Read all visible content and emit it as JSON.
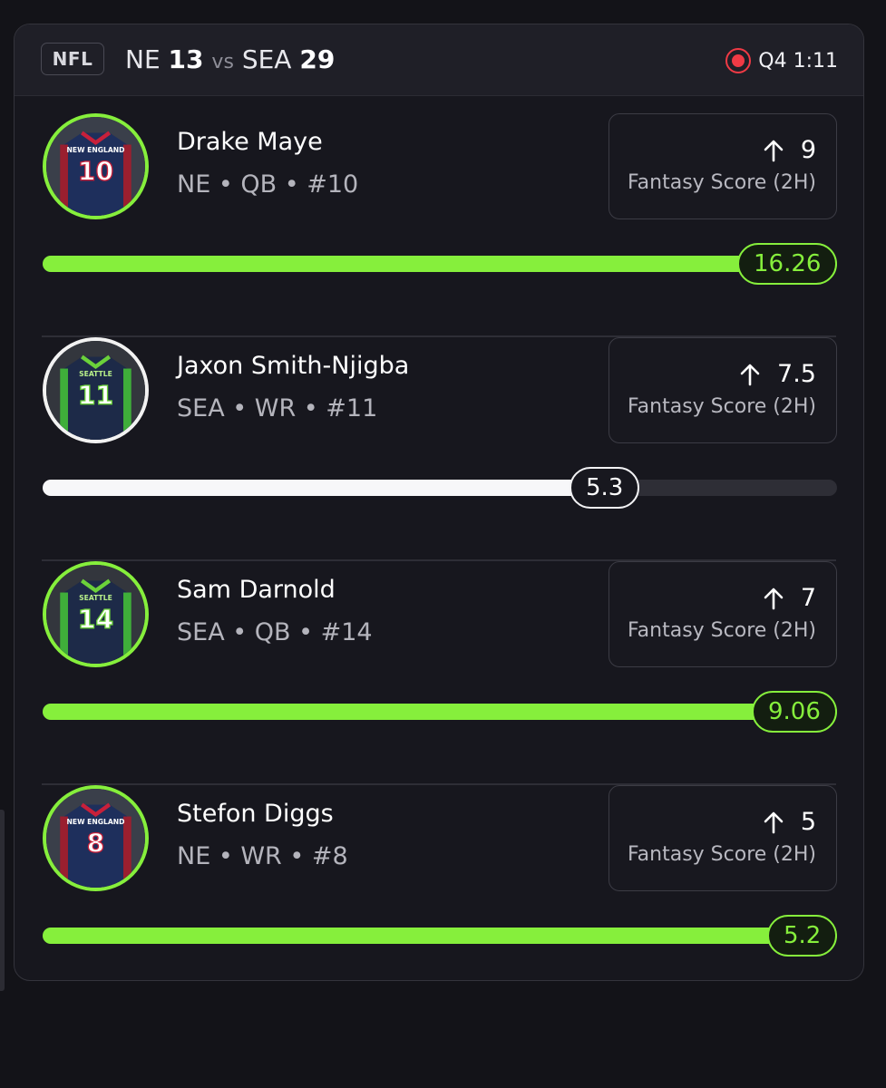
{
  "game": {
    "league": "NFL",
    "away_team": "NE",
    "away_score": "13",
    "vs": "vs",
    "home_team": "SEA",
    "home_score": "29",
    "period_clock": "Q4 1:11",
    "status_icon": "live-record-icon",
    "live_color": "#f03a45"
  },
  "accent_color": "#86ef3c",
  "players": [
    {
      "name": "Drake Maye",
      "meta": "NE • QB • #10",
      "line_value": "9",
      "stat_label": "Fantasy Score (2H)",
      "current": "16.26",
      "progress": 1.0,
      "over": true,
      "jersey_team": "NEW ENGLAND",
      "jersey_number": "10"
    },
    {
      "name": "Jaxon Smith-Njigba",
      "meta": "SEA • WR • #11",
      "line_value": "7.5",
      "stat_label": "Fantasy Score (2H)",
      "current": "5.3",
      "progress": 0.707,
      "over": false,
      "jersey_team": "SEATTLE",
      "jersey_number": "11"
    },
    {
      "name": "Sam Darnold",
      "meta": "SEA • QB • #14",
      "line_value": "7",
      "stat_label": "Fantasy Score (2H)",
      "current": "9.06",
      "progress": 1.0,
      "over": true,
      "jersey_team": "SEATTLE",
      "jersey_number": "14"
    },
    {
      "name": "Stefon Diggs",
      "meta": "NE • WR • #8",
      "line_value": "5",
      "stat_label": "Fantasy Score (2H)",
      "current": "5.2",
      "progress": 1.0,
      "over": true,
      "jersey_team": "NEW ENGLAND",
      "jersey_number": "8"
    }
  ]
}
